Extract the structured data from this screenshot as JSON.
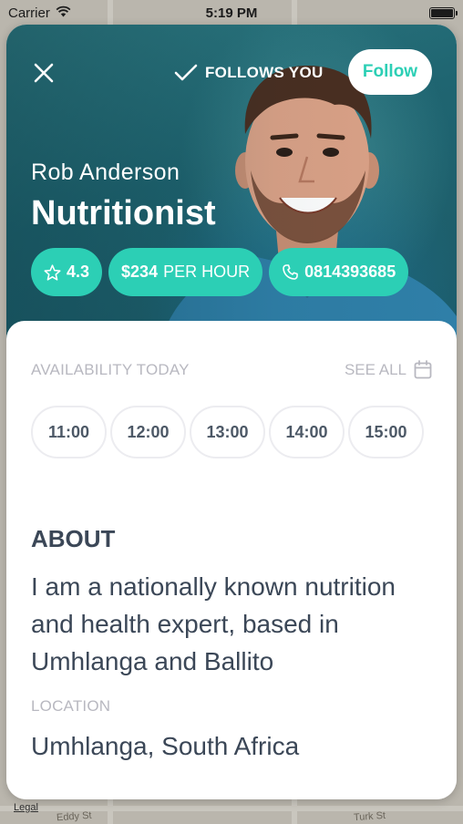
{
  "status_bar": {
    "carrier": "Carrier",
    "time": "5:19 PM"
  },
  "map": {
    "legal": "Legal",
    "street_1": "Eddy St",
    "street_2": "Turk St"
  },
  "header": {
    "follows_you": "FOLLOWS YOU",
    "follow_button": "Follow"
  },
  "profile": {
    "name": "Rob Anderson",
    "title": "Nutritionist",
    "rating": "4.3",
    "price": "$234",
    "price_unit": "PER HOUR",
    "phone": "0814393685"
  },
  "availability": {
    "label": "AVAILABILITY TODAY",
    "see_all": "SEE ALL",
    "slots": [
      "11:00",
      "12:00",
      "13:00",
      "14:00",
      "15:00"
    ]
  },
  "about": {
    "heading": "ABOUT",
    "text": "I am a nationally known nutrition and health expert, based in Umhlanga and Ballito"
  },
  "location": {
    "label": "LOCATION",
    "value": "Umhlanga, South Africa"
  },
  "colors": {
    "accent": "#2ccfb5",
    "text_dark": "#3b4757",
    "text_muted": "#b8b8c0"
  },
  "icons": [
    "wifi-icon",
    "battery-icon",
    "close-icon",
    "check-icon",
    "star-icon",
    "phone-icon",
    "calendar-icon"
  ]
}
